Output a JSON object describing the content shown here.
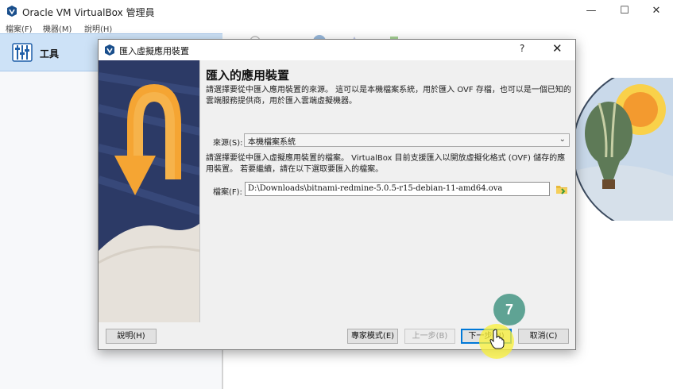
{
  "window": {
    "title": "Oracle VM VirtualBox 管理員",
    "minimize": "—",
    "maximize": "☐",
    "close": "✕"
  },
  "menu": {
    "items": [
      "檔案(F)",
      "機器(M)",
      "說明(H)"
    ]
  },
  "left_panel": {
    "tools_label": "工具"
  },
  "dialog": {
    "title": "匯入虛擬應用裝置",
    "help_glyph": "?",
    "close_glyph": "✕",
    "heading": "匯入的應用裝置",
    "intro_text": "請選擇要從中匯入應用裝置的來源。 這可以是本機檔案系統，用於匯入 OVF 存檔，也可以是一個已知的雲端服務提供商，用於匯入雲端虛擬機器。",
    "source_label": "來源(S):",
    "source_value": "本機檔案系統",
    "file_help_text": "請選擇要從中匯入虛擬應用裝置的檔案。 VirtualBox 目前支援匯入以開放虛擬化格式 (OVF) 儲存的應用裝置。 若要繼續，請在以下選取要匯入的檔案。",
    "file_label": "檔案(F):",
    "file_value": "D:\\Downloads\\bitnami-redmine-5.0.5-r15-debian-11-amd64.ova",
    "buttons": {
      "help": "說明(H)",
      "expert": "專家模式(E)",
      "back": "上一步(B)",
      "next": "下一步(N)",
      "cancel": "取消(C)"
    }
  },
  "annotation": {
    "step_number": "7"
  },
  "colors": {
    "tools_selected_bg": "#cde2f7",
    "step_badge": "#5fa394",
    "cursor_highlight": "#f8f03c",
    "default_button_border": "#0078d7"
  }
}
